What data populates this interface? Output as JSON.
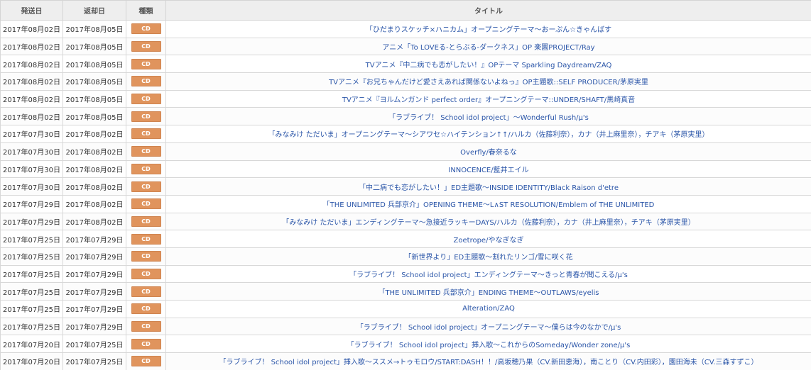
{
  "headers": {
    "send_date": "発送日",
    "return_date": "返却日",
    "type": "種類",
    "title": "タイトル"
  },
  "rows": [
    {
      "send": "2017年08月02日",
      "ret": "2017年08月05日",
      "type": "CD",
      "title": "「ひだまりスケッチ×ハニカム」オープニングテーマ～おーぷん☆きゃんばす"
    },
    {
      "send": "2017年08月02日",
      "ret": "2017年08月05日",
      "type": "CD",
      "title": "アニメ「To LOVEる-とらぶる-ダークネス」OP 楽園PROJECT/Ray"
    },
    {
      "send": "2017年08月02日",
      "ret": "2017年08月05日",
      "type": "CD",
      "title": "TVアニメ『中二病でも恋がしたい！』OPテーマ Sparkling Daydream/ZAQ"
    },
    {
      "send": "2017年08月02日",
      "ret": "2017年08月05日",
      "type": "CD",
      "title": "TVアニメ『お兄ちゃんだけど愛さえあれば関係ないよねっ』OP主題歌::SELF PRODUCER/茅原実里"
    },
    {
      "send": "2017年08月02日",
      "ret": "2017年08月05日",
      "type": "CD",
      "title": "TVアニメ『ヨルムンガンド perfect order』オープニングテーマ::UNDER/SHAFT/黒崎真音"
    },
    {
      "send": "2017年08月02日",
      "ret": "2017年08月05日",
      "type": "CD",
      "title": "「ラブライブ！ School idol project」～Wonderful Rush/μ's"
    },
    {
      "send": "2017年07月30日",
      "ret": "2017年08月02日",
      "type": "CD",
      "title": "「みなみけ ただいま」オープニングテーマ～シアワセ☆ハイテンション↑↑/ハルカ（佐藤利奈），カナ（井上麻里奈），チアキ（茅原実里）"
    },
    {
      "send": "2017年07月30日",
      "ret": "2017年08月02日",
      "type": "CD",
      "title": "Overfly/春奈るな"
    },
    {
      "send": "2017年07月30日",
      "ret": "2017年08月02日",
      "type": "CD",
      "title": "INNOCENCE/藍井エイル"
    },
    {
      "send": "2017年07月30日",
      "ret": "2017年08月02日",
      "type": "CD",
      "title": "「中二病でも恋がしたい！」ED主題歌～INSIDE IDENTITY/Black Raison d'etre"
    },
    {
      "send": "2017年07月29日",
      "ret": "2017年08月02日",
      "type": "CD",
      "title": "「THE UNLIMITED 兵部京介」OPENING THEME～L∧ST RESOLUTION/Emblem of THE UNLIMITED"
    },
    {
      "send": "2017年07月29日",
      "ret": "2017年08月02日",
      "type": "CD",
      "title": "「みなみけ ただいま」エンディングテーマ～急接近ラッキーDAYS/ハルカ（佐藤利奈），カナ（井上麻里奈），チアキ（茅原実里）"
    },
    {
      "send": "2017年07月25日",
      "ret": "2017年07月29日",
      "type": "CD",
      "title": "Zoetrope/やなぎなぎ"
    },
    {
      "send": "2017年07月25日",
      "ret": "2017年07月29日",
      "type": "CD",
      "title": "「新世界より」ED主題歌～割れたリンゴ/雪に咲く花"
    },
    {
      "send": "2017年07月25日",
      "ret": "2017年07月29日",
      "type": "CD",
      "title": "「ラブライブ！ School idol project」エンディングテーマ～きっと青春が聞こえる/μ's"
    },
    {
      "send": "2017年07月25日",
      "ret": "2017年07月29日",
      "type": "CD",
      "title": "「THE UNLIMITED 兵部京介」ENDING THEME～OUTLAWS/eyelis"
    },
    {
      "send": "2017年07月25日",
      "ret": "2017年07月29日",
      "type": "CD",
      "title": "Alteration/ZAQ"
    },
    {
      "send": "2017年07月25日",
      "ret": "2017年07月29日",
      "type": "CD",
      "title": "「ラブライブ！ School idol project」オープニングテーマ～僕らは今のなかで/μ's"
    },
    {
      "send": "2017年07月20日",
      "ret": "2017年07月25日",
      "type": "CD",
      "title": "「ラブライブ！ School idol project」挿入歌～これからのSomeday/Wonder zone/μ's"
    },
    {
      "send": "2017年07月20日",
      "ret": "2017年07月25日",
      "type": "CD",
      "title": "「ラブライブ！ School idol project」挿入歌～ススメ→トゥモロウ/START:DASH！！/高坂穂乃果（CV.新田恵海），南ことり（CV.内田彩），園田海未（CV.三森すずこ）"
    }
  ],
  "colors": {
    "badge": "#e0945d",
    "link": "#2a55a8",
    "header_bg": "#eeeeee"
  }
}
